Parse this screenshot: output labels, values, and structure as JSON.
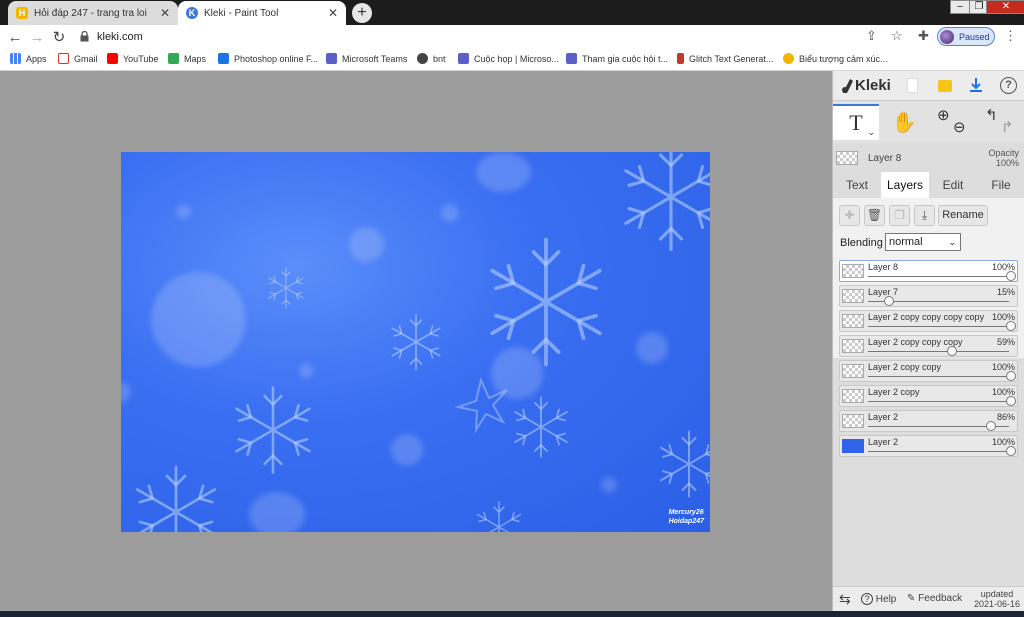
{
  "browser": {
    "tabs": [
      {
        "title": "Hỏi đáp 247 - trang tra loi",
        "active": false,
        "icon": "H"
      },
      {
        "title": "Kleki - Paint Tool",
        "active": true,
        "icon": "K"
      }
    ],
    "new_tab": "+",
    "url": "kleki.com",
    "profile_label": "Paused",
    "window": {
      "minimize": "–",
      "maximize": "❐",
      "close": "✕"
    }
  },
  "bookmarks": [
    {
      "label": "Apps",
      "color": "#4285f4"
    },
    {
      "label": "Gmail",
      "color": "#d93025"
    },
    {
      "label": "YouTube",
      "color": "#ff0000"
    },
    {
      "label": "Maps",
      "color": "#34a853"
    },
    {
      "label": "Photoshop online F...",
      "color": "#1a73e8"
    },
    {
      "label": "Microsoft Teams",
      "color": "#5b5fc7"
    },
    {
      "label": "bnt",
      "color": "#444444"
    },
    {
      "label": "Cuộc họp | Microso...",
      "color": "#5b5fc7"
    },
    {
      "label": "Tham gia cuộc hội t...",
      "color": "#5b5fc7"
    },
    {
      "label": "Glitch Text Generat...",
      "color": "#c0392b"
    },
    {
      "label": "Biểu tượng cảm xúc...",
      "color": "#f4b400"
    }
  ],
  "artwork": {
    "watermark_line1": "Mercury26",
    "watermark_line2": "Hoidap247"
  },
  "kleki": {
    "logo": "Kleki",
    "current_layer": "Layer 8",
    "opacity_label": "Opacity",
    "opacity_value": "100%",
    "tabs": [
      "Text",
      "Layers",
      "Edit",
      "File"
    ],
    "active_tab": "Layers",
    "rename_label": "Rename",
    "blending_label": "Blending",
    "blending_value": "normal",
    "layers": [
      {
        "name": "Layer 8",
        "opacity": "100%",
        "level": 1.0,
        "selected": true,
        "filled": false
      },
      {
        "name": "Layer 7",
        "opacity": "15%",
        "level": 0.15,
        "selected": false,
        "filled": false
      },
      {
        "name": "Layer 2 copy copy copy copy",
        "opacity": "100%",
        "level": 1.0,
        "selected": false,
        "filled": false
      },
      {
        "name": "Layer 2 copy copy copy",
        "opacity": "59%",
        "level": 0.59,
        "selected": false,
        "filled": false
      },
      {
        "name": "Layer 2 copy copy",
        "opacity": "100%",
        "level": 1.0,
        "selected": false,
        "filled": false
      },
      {
        "name": "Layer 2 copy",
        "opacity": "100%",
        "level": 1.0,
        "selected": false,
        "filled": false
      },
      {
        "name": "Layer 2",
        "opacity": "86%",
        "level": 0.86,
        "selected": false,
        "filled": false
      },
      {
        "name": "Layer 2",
        "opacity": "100%",
        "level": 1.0,
        "selected": false,
        "filled": true
      }
    ],
    "footer": {
      "help": "Help",
      "feedback": "Feedback",
      "updated_label": "updated",
      "updated_date": "2021-06-16"
    }
  }
}
